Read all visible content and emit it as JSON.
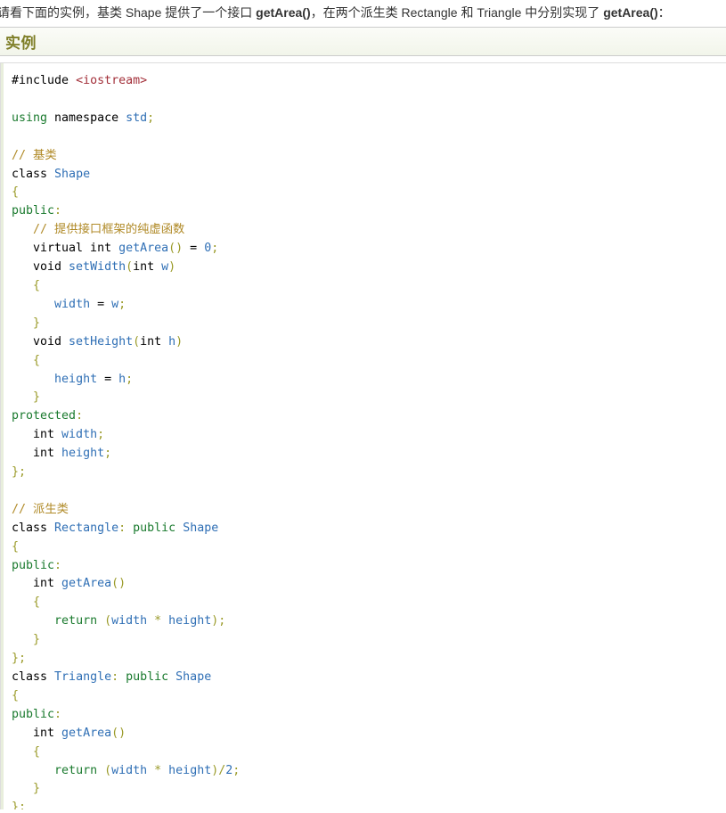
{
  "intro": {
    "segments": [
      {
        "text": "请看下面的实例，基类 Shape 提供了一个接口 ",
        "bold": false
      },
      {
        "text": "getArea()",
        "bold": true
      },
      {
        "text": "，在两个派生类 Rectangle 和 Triangle 中分别实现了 ",
        "bold": false
      },
      {
        "text": "getArea()",
        "bold": true
      },
      {
        "text": "：",
        "bold": false
      }
    ],
    "full_text": "请看下面的实例，基类 Shape 提供了一个接口 getArea()，在两个派生类 Rectangle 和 Triangle 中分别实现了 getArea()："
  },
  "example_header": {
    "label": "实例",
    "text_color": "#7e7e27",
    "background_top": "#fbfcf8",
    "background_bottom": "#f2f5ea",
    "border_color": "#cccccc"
  },
  "code_block": {
    "language": "cpp",
    "accent_bar_color": "#e8eedc",
    "border_color": "#dddddd",
    "background": "#ffffff",
    "colors": {
      "keyword": "#000000",
      "green": "#1a7a2e",
      "blue": "#2f6fb5",
      "comment": "#b08a27",
      "string": "#a3303a",
      "brace": "#9a9a28",
      "number": "#2f6fb5"
    },
    "lines": [
      [
        {
          "t": "#include ",
          "c": "plain"
        },
        {
          "t": "<iostream>",
          "c": "string"
        }
      ],
      [],
      [
        {
          "t": "using",
          "c": "green"
        },
        {
          "t": " namespace ",
          "c": "plain"
        },
        {
          "t": "std",
          "c": "blue"
        },
        {
          "t": ";",
          "c": "punct"
        }
      ],
      [],
      [
        {
          "t": "// 基类",
          "c": "comment"
        }
      ],
      [
        {
          "t": "class ",
          "c": "kw"
        },
        {
          "t": "Shape",
          "c": "blue"
        }
      ],
      [
        {
          "t": "{",
          "c": "brace"
        }
      ],
      [
        {
          "t": "public",
          "c": "green"
        },
        {
          "t": ":",
          "c": "punct"
        }
      ],
      [
        {
          "t": "   // 提供接口框架的纯虚函数",
          "c": "comment"
        }
      ],
      [
        {
          "t": "   virtual int ",
          "c": "kw"
        },
        {
          "t": "getArea",
          "c": "blue"
        },
        {
          "t": "()",
          "c": "brace"
        },
        {
          "t": " = ",
          "c": "plain"
        },
        {
          "t": "0",
          "c": "num"
        },
        {
          "t": ";",
          "c": "punct"
        }
      ],
      [
        {
          "t": "   void ",
          "c": "kw"
        },
        {
          "t": "setWidth",
          "c": "blue"
        },
        {
          "t": "(",
          "c": "brace"
        },
        {
          "t": "int ",
          "c": "kw"
        },
        {
          "t": "w",
          "c": "blue"
        },
        {
          "t": ")",
          "c": "brace"
        }
      ],
      [
        {
          "t": "   {",
          "c": "brace"
        }
      ],
      [
        {
          "t": "      ",
          "c": "plain"
        },
        {
          "t": "width",
          "c": "blue"
        },
        {
          "t": " = ",
          "c": "plain"
        },
        {
          "t": "w",
          "c": "blue"
        },
        {
          "t": ";",
          "c": "punct"
        }
      ],
      [
        {
          "t": "   }",
          "c": "brace"
        }
      ],
      [
        {
          "t": "   void ",
          "c": "kw"
        },
        {
          "t": "setHeight",
          "c": "blue"
        },
        {
          "t": "(",
          "c": "brace"
        },
        {
          "t": "int ",
          "c": "kw"
        },
        {
          "t": "h",
          "c": "blue"
        },
        {
          "t": ")",
          "c": "brace"
        }
      ],
      [
        {
          "t": "   {",
          "c": "brace"
        }
      ],
      [
        {
          "t": "      ",
          "c": "plain"
        },
        {
          "t": "height",
          "c": "blue"
        },
        {
          "t": " = ",
          "c": "plain"
        },
        {
          "t": "h",
          "c": "blue"
        },
        {
          "t": ";",
          "c": "punct"
        }
      ],
      [
        {
          "t": "   }",
          "c": "brace"
        }
      ],
      [
        {
          "t": "protected",
          "c": "green"
        },
        {
          "t": ":",
          "c": "punct"
        }
      ],
      [
        {
          "t": "   int ",
          "c": "kw"
        },
        {
          "t": "width",
          "c": "blue"
        },
        {
          "t": ";",
          "c": "punct"
        }
      ],
      [
        {
          "t": "   int ",
          "c": "kw"
        },
        {
          "t": "height",
          "c": "blue"
        },
        {
          "t": ";",
          "c": "punct"
        }
      ],
      [
        {
          "t": "};",
          "c": "brace"
        }
      ],
      [],
      [
        {
          "t": "// 派生类",
          "c": "comment"
        }
      ],
      [
        {
          "t": "class ",
          "c": "kw"
        },
        {
          "t": "Rectangle",
          "c": "blue"
        },
        {
          "t": ": ",
          "c": "punct"
        },
        {
          "t": "public",
          "c": "green"
        },
        {
          "t": " ",
          "c": "plain"
        },
        {
          "t": "Shape",
          "c": "blue"
        }
      ],
      [
        {
          "t": "{",
          "c": "brace"
        }
      ],
      [
        {
          "t": "public",
          "c": "green"
        },
        {
          "t": ":",
          "c": "punct"
        }
      ],
      [
        {
          "t": "   int ",
          "c": "kw"
        },
        {
          "t": "getArea",
          "c": "blue"
        },
        {
          "t": "()",
          "c": "brace"
        }
      ],
      [
        {
          "t": "   {",
          "c": "brace"
        }
      ],
      [
        {
          "t": "      ",
          "c": "plain"
        },
        {
          "t": "return",
          "c": "green"
        },
        {
          "t": " (",
          "c": "brace"
        },
        {
          "t": "width",
          "c": "blue"
        },
        {
          "t": " * ",
          "c": "brace"
        },
        {
          "t": "height",
          "c": "blue"
        },
        {
          "t": ");",
          "c": "brace"
        }
      ],
      [
        {
          "t": "   }",
          "c": "brace"
        }
      ],
      [
        {
          "t": "};",
          "c": "brace"
        }
      ],
      [
        {
          "t": "class ",
          "c": "kw"
        },
        {
          "t": "Triangle",
          "c": "blue"
        },
        {
          "t": ": ",
          "c": "punct"
        },
        {
          "t": "public",
          "c": "green"
        },
        {
          "t": " ",
          "c": "plain"
        },
        {
          "t": "Shape",
          "c": "blue"
        }
      ],
      [
        {
          "t": "{",
          "c": "brace"
        }
      ],
      [
        {
          "t": "public",
          "c": "green"
        },
        {
          "t": ":",
          "c": "punct"
        }
      ],
      [
        {
          "t": "   int ",
          "c": "kw"
        },
        {
          "t": "getArea",
          "c": "blue"
        },
        {
          "t": "()",
          "c": "brace"
        }
      ],
      [
        {
          "t": "   {",
          "c": "brace"
        }
      ],
      [
        {
          "t": "      ",
          "c": "plain"
        },
        {
          "t": "return",
          "c": "green"
        },
        {
          "t": " (",
          "c": "brace"
        },
        {
          "t": "width",
          "c": "blue"
        },
        {
          "t": " * ",
          "c": "brace"
        },
        {
          "t": "height",
          "c": "blue"
        },
        {
          "t": ")/",
          "c": "brace"
        },
        {
          "t": "2",
          "c": "num"
        },
        {
          "t": ";",
          "c": "punct"
        }
      ],
      [
        {
          "t": "   }",
          "c": "brace"
        }
      ],
      [
        {
          "t": "};",
          "c": "brace"
        }
      ]
    ]
  }
}
